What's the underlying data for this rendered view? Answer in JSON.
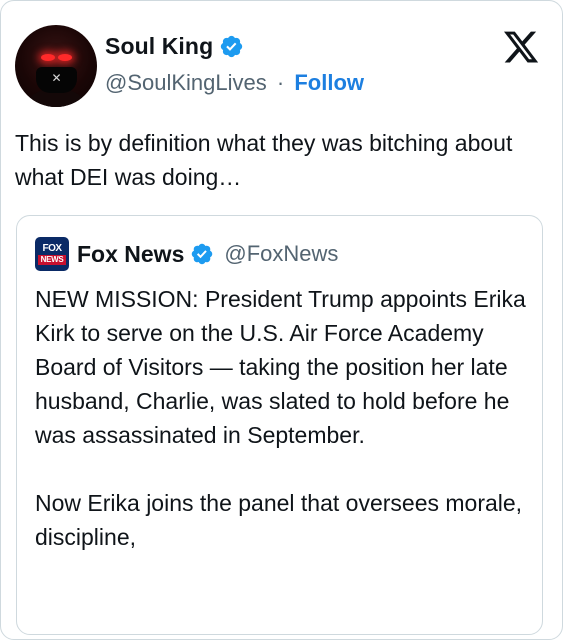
{
  "author": {
    "display_name": "Soul King",
    "handle": "@SoulKingLives",
    "separator": "·",
    "follow_label": "Follow",
    "avatar_icon": "masked-figure-avatar"
  },
  "tweet": {
    "text": "This is by definition what they was bitching about what DEI was doing…"
  },
  "quoted_tweet": {
    "logo_top": "FOX",
    "logo_bottom": "NEWS",
    "display_name": "Fox News",
    "handle": "@FoxNews",
    "paragraphs": [
      "NEW MISSION: President Trump appoints Erika Kirk to serve on the U.S. Air Force Academy Board of Visitors — taking the position her late husband, Charlie, was slated to hold before he was assassinated in September.",
      "Now Erika joins the panel that oversees morale, discipline,"
    ]
  },
  "colors": {
    "verified_blue": "#1d9bf0",
    "follow_blue": "#1d7fe0",
    "secondary_text": "#536471",
    "border": "#cfd9de"
  },
  "icons": [
    "verified-badge-icon",
    "x-logo-icon",
    "fox-news-logo"
  ]
}
